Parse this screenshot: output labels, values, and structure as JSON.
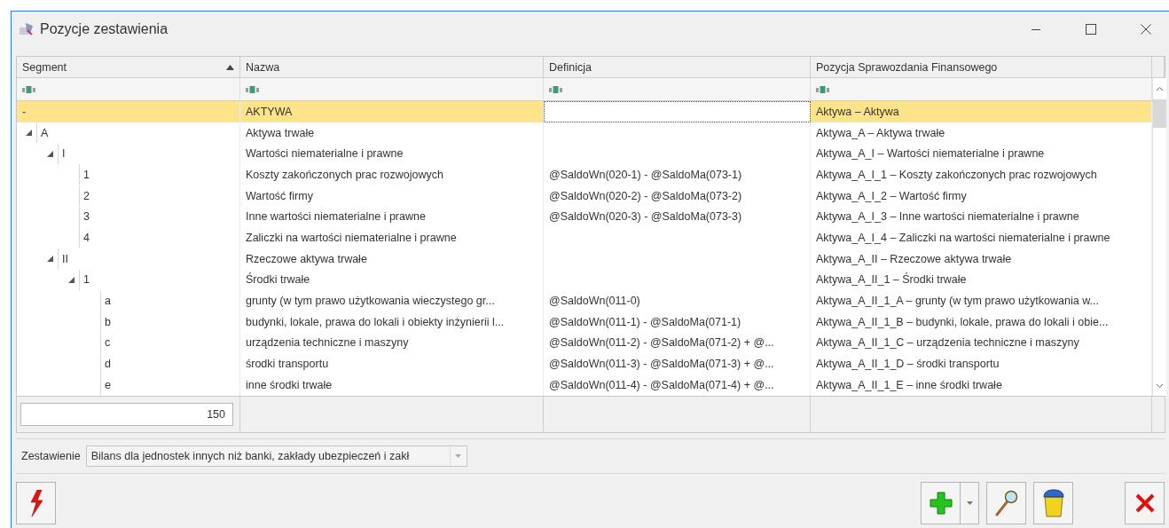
{
  "window": {
    "title": "Pozycje zestawienia"
  },
  "window_controls": [
    {
      "kind": "minimize"
    },
    {
      "kind": "maximize"
    },
    {
      "kind": "close"
    }
  ],
  "table": {
    "columns": [
      {
        "label": "Segment",
        "sorted": true,
        "focused": false
      },
      {
        "label": "Nazwa",
        "sorted": false,
        "focused": false
      },
      {
        "label": "Definicja",
        "sorted": false,
        "focused": true
      },
      {
        "label": "Pozycja Sprawozdania Finansowego",
        "sorted": false,
        "focused": false
      }
    ],
    "rows": [
      {
        "segment": "-",
        "name": "AKTYWA",
        "position": "Aktywa – Aktywa",
        "selected": true
      },
      {
        "segment": "A",
        "name": "Aktywa trwałe",
        "position": "Aktywa_A – Aktywa trwałe",
        "selected": false,
        "expanded": true,
        "children": [
          {
            "segment": "I",
            "name": "Wartości niematerialne i prawne",
            "position": "Aktywa_A_I – Wartości niematerialne i prawne",
            "selected": false,
            "expanded": true,
            "children": [
              {
                "segment": "1",
                "name": "Koszty zakończonych prac rozwojowych",
                "definition": "@SaldoWn(020-1) - @SaldoMa(073-1)",
                "position": "Aktywa_A_I_1 – Koszty zakończonych prac rozwojowych",
                "selected": false
              },
              {
                "segment": "2",
                "name": "Wartość firmy",
                "definition": "@SaldoWn(020-2) - @SaldoMa(073-2)",
                "position": "Aktywa_A_I_2 – Wartość firmy",
                "selected": false
              },
              {
                "segment": "3",
                "name": "Inne wartości niematerialne i prawne",
                "definition": "@SaldoWn(020-3) - @SaldoMa(073-3)",
                "position": "Aktywa_A_I_3 – Inne wartości niematerialne i prawne",
                "selected": false
              },
              {
                "segment": "4",
                "name": "Zaliczki na wartości niematerialne i prawne",
                "position": "Aktywa_A_I_4 – Zaliczki na wartości niematerialne i prawne",
                "selected": false
              }
            ]
          },
          {
            "segment": "II",
            "name": "Rzeczowe aktywa trwałe",
            "position": "Aktywa_A_II – Rzeczowe aktywa trwałe",
            "selected": false,
            "expanded": true,
            "children": [
              {
                "segment": "1",
                "name": "Środki trwałe",
                "position": "Aktywa_A_II_1 – Środki trwałe",
                "selected": false,
                "expanded": true,
                "children": [
                  {
                    "segment": "a",
                    "name": "grunty (w tym prawo użytkowania wieczystego gr...",
                    "definition": "@SaldoWn(011-0)",
                    "position": "Aktywa_A_II_1_A – grunty (w tym prawo użytkowania w...",
                    "selected": false
                  },
                  {
                    "segment": "b",
                    "name": "budynki, lokale, prawa do lokali i obiekty inżynierii l...",
                    "definition": "@SaldoWn(011-1) - @SaldoMa(071-1)",
                    "position": "Aktywa_A_II_1_B – budynki, lokale, prawa do lokali i obie...",
                    "selected": false
                  },
                  {
                    "segment": "c",
                    "name": "urządzenia techniczne i maszyny",
                    "definition": "@SaldoWn(011-2) - @SaldoMa(071-2) + @...",
                    "position": "Aktywa_A_II_1_C – urządzenia techniczne i maszyny",
                    "selected": false
                  },
                  {
                    "segment": "d",
                    "name": "środki transportu",
                    "definition": "@SaldoWn(011-3) - @SaldoMa(071-3) + @...",
                    "position": "Aktywa_A_II_1_D – środki transportu",
                    "selected": false
                  },
                  {
                    "segment": "e",
                    "name": "inne środki trwałe",
                    "definition": "@SaldoWn(011-4) - @SaldoMa(071-4) + @...",
                    "position": "Aktywa_A_II_1_E – inne środki trwałe",
                    "selected": false
                  }
                ]
              }
            ]
          }
        ]
      }
    ],
    "footer": {
      "count": "150"
    }
  },
  "filter": {
    "label": "Zestawienie",
    "value": "Bilans dla jednostek innych niż banki, zakłady ubezpieczeń i zakł"
  },
  "toolbar_left": [
    {
      "kind": "generate"
    }
  ],
  "toolbar_right": [
    {
      "kind": "add",
      "dropdown": true
    },
    {
      "kind": "edit",
      "dropdown": false
    },
    {
      "kind": "delete",
      "dropdown": false
    },
    {
      "kind": "close",
      "dropdown": false
    }
  ]
}
